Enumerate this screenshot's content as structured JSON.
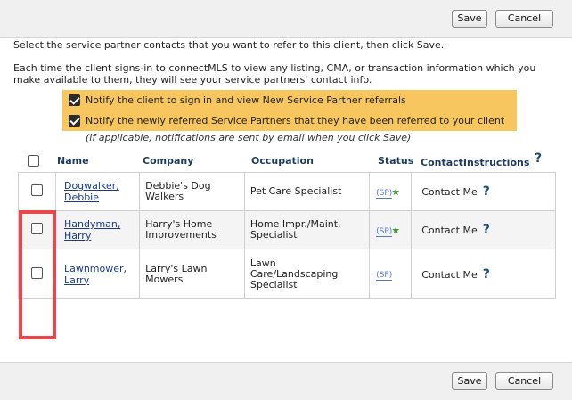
{
  "toolbar": {
    "save_label": "Save",
    "cancel_label": "Cancel"
  },
  "intro": {
    "line1": "Select the service partner contacts that you want to refer to this client, then click Save.",
    "line2": "Each time the client signs-in to connectMLS to view any listing, CMA, or transaction information which you make available to them, they will see your service partners' contact info."
  },
  "notifications": [
    {
      "label": "Notify the client to sign in and view New Service Partner referrals",
      "checked": true
    },
    {
      "label": "Notify the newly referred Service Partners that they have been referred to your client",
      "checked": true
    }
  ],
  "hint": "(if applicable, notifications are sent by email when you click Save)",
  "table": {
    "headers": {
      "name": "Name",
      "company": "Company",
      "occupation": "Occupation",
      "status": "Status",
      "contact": "ContactInstructions",
      "help": "?"
    },
    "rows": [
      {
        "name_line1": "Dogwalker,",
        "name_line2": "Debbie",
        "company_line1": "Debbie's Dog",
        "company_line2": "Walkers",
        "occupation_line1": "Pet Care Specialist",
        "occupation_line2": "",
        "occupation_line3": "",
        "status": "(SP)",
        "starred": true,
        "contact": "Contact Me",
        "help": "?"
      },
      {
        "name_line1": "Handyman,",
        "name_line2": "Harry",
        "company_line1": "Harry's Home",
        "company_line2": "Improvements",
        "occupation_line1": "Home Impr./Maint.",
        "occupation_line2": "Specialist",
        "occupation_line3": "",
        "status": "(SP)",
        "starred": true,
        "contact": "Contact Me",
        "help": "?"
      },
      {
        "name_line1": "Lawnmower,",
        "name_line2": "Larry",
        "company_line1": "Larry's Lawn",
        "company_line2": "Mowers",
        "occupation_line1": "Lawn",
        "occupation_line2": "Care/Landscaping",
        "occupation_line3": "Specialist",
        "status": "(SP)",
        "starred": false,
        "contact": "Contact Me",
        "help": "?"
      }
    ]
  },
  "icons": {
    "star": "star-icon",
    "help": "help-question-icon"
  },
  "colors": {
    "notify_bg": "#f8c65e",
    "highlight_border": "#e8474c",
    "link": "#1a3a8a",
    "star": "#3d9a2e"
  }
}
